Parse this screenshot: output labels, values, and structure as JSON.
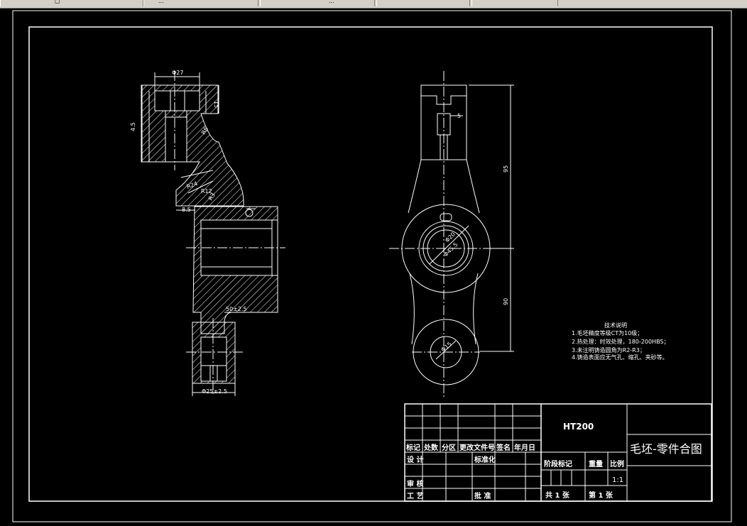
{
  "topbar": {
    "seg1": "▢",
    "seg2": "...",
    "seg3": "..."
  },
  "dims": {
    "phi27": "Φ27",
    "d15": "15",
    "tol": "4.5",
    "r24": "R24",
    "r12": "R12",
    "r3": "R3",
    "r6": "R6",
    "d8_5": "8.5",
    "d50": "50±2.5",
    "phi25": "Φ25±2.5",
    "d5": "5",
    "d95": "95",
    "d90": "90",
    "phi_small": "Φ20",
    "phi_mid": "Φ45.5",
    "phi_bottom": "Φ15"
  },
  "notes": {
    "title": "技术说明",
    "lines": [
      "1.毛坯精度等级CT为10级；",
      "2.热处理：时效处理，180-200HBS；",
      "3.未注明铸造圆角为R2-R3；",
      "4.铸造表面应无气孔、缩孔、夹砂等。"
    ]
  },
  "titleblock": {
    "material": "HT200",
    "drawing_name": "毛坯-零件合图",
    "row_labels": [
      "标记",
      "处数",
      "分区",
      "更改文件号",
      "签名",
      "年月日"
    ],
    "design": "设 计",
    "standard": "标准化",
    "review": "审 核",
    "process": "工 艺",
    "approve": "批 准",
    "stage": "阶段标记",
    "weight": "重量",
    "scale": "比例",
    "scale_val": "1:1",
    "sheets_total": "共 1 张",
    "sheet_no": "第 1 张"
  }
}
